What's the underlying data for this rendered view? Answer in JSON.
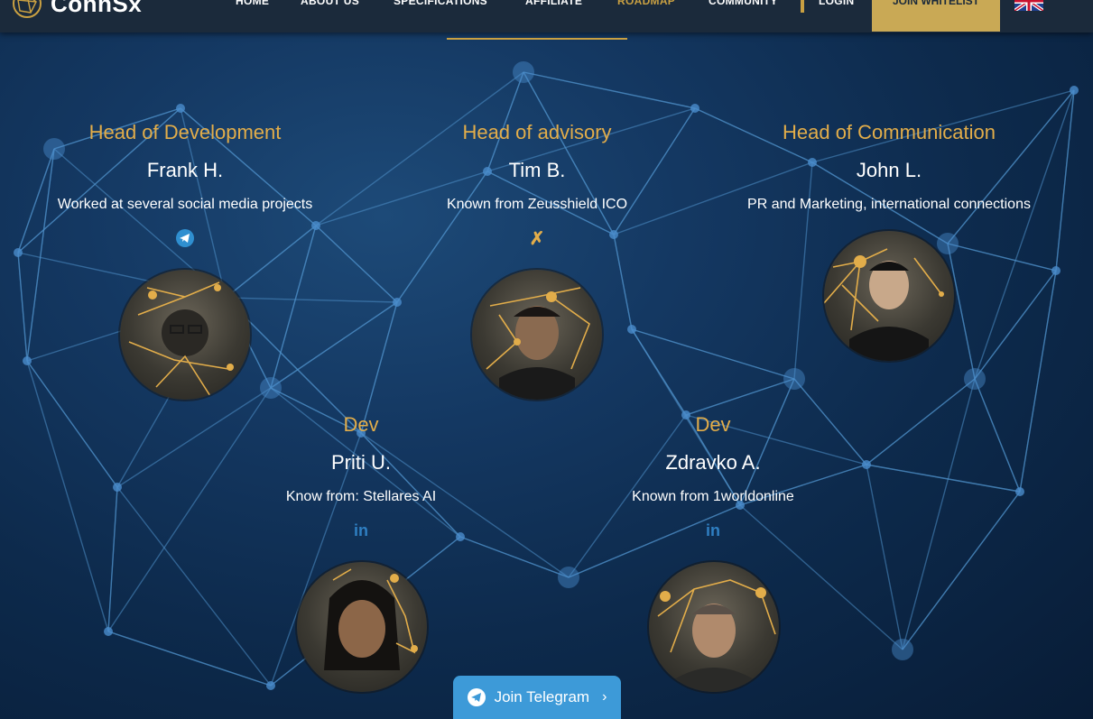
{
  "brand": {
    "name": "ConnSx"
  },
  "nav": {
    "items": [
      "HOME",
      "ABOUT US",
      "SPECIFICATIONS",
      "AFFILIATE",
      "ROADMAP",
      "COMMUNITY"
    ],
    "active": "ROADMAP",
    "login": "LOGIN",
    "whitelist": "JOIN WHITELIST"
  },
  "team": [
    {
      "role": "Head of Development",
      "name": "Frank H.",
      "desc": "Worked at several social media projects",
      "social": "telegram-icon"
    },
    {
      "role": "Head of advisory",
      "name": "Tim B.",
      "desc": "Known from Zeusshield ICO",
      "social": "xing-icon"
    },
    {
      "role": "Head of Communication",
      "name": "John L.",
      "desc": "PR and Marketing, international connections",
      "social": ""
    },
    {
      "role": "Dev",
      "name": "Priti U.",
      "desc": "Know from: Stellares AI",
      "social": "linkedin-icon"
    },
    {
      "role": "Dev",
      "name": "Zdravko A.",
      "desc": "Known from 1worldonline",
      "social": "linkedin-icon"
    }
  ],
  "social_labels": {
    "linkedin": "in",
    "xing": "✗"
  },
  "telegram": {
    "label": "Join Telegram"
  },
  "colors": {
    "accent": "#c9a042",
    "role": "#e2ad4a",
    "telegram": "#3d9ad8",
    "background": "#0d2a4c"
  }
}
